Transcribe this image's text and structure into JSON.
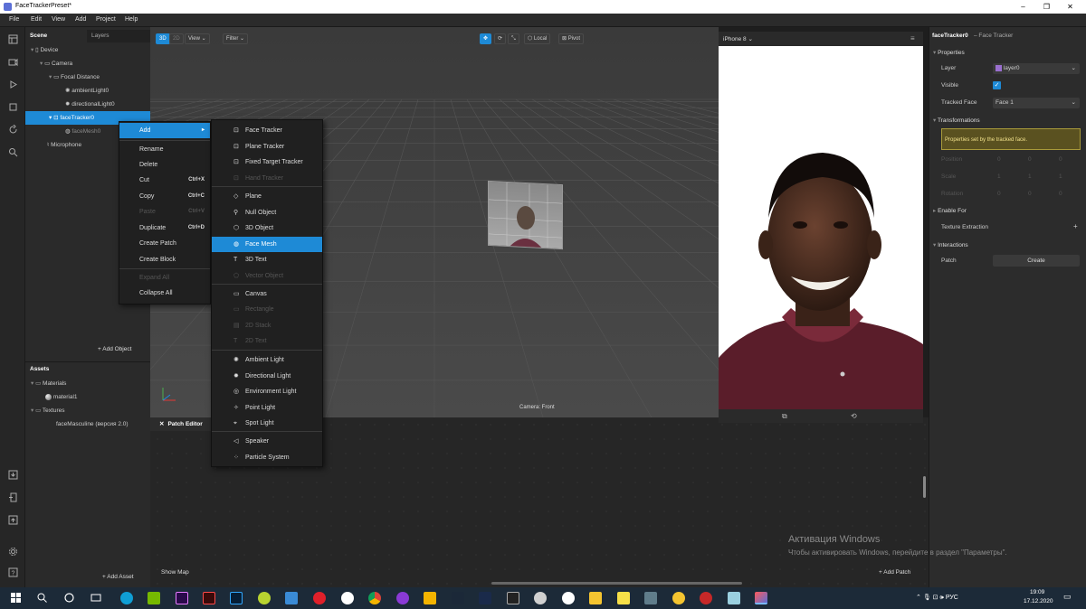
{
  "window": {
    "title": "FaceTrackerPreset*"
  },
  "menu": [
    "File",
    "Edit",
    "View",
    "Add",
    "Project",
    "Help"
  ],
  "scene_panel": {
    "tabs": [
      "Scene",
      "Layers"
    ],
    "tree": [
      {
        "label": "Device",
        "indent": 0
      },
      {
        "label": "Camera",
        "indent": 1
      },
      {
        "label": "Focal Distance",
        "indent": 2
      },
      {
        "label": "ambientLight0",
        "indent": 3
      },
      {
        "label": "directionalLight0",
        "indent": 3
      },
      {
        "label": "faceTracker0",
        "indent": 2,
        "selected": true
      },
      {
        "label": "faceMesh0",
        "indent": 3
      },
      {
        "label": "Microphone",
        "indent": 1
      }
    ],
    "add_object": "Add Object"
  },
  "assets_panel": {
    "title": "Assets",
    "items": [
      "Materials",
      "material1",
      "Textures",
      "faceMasculine (версия 2.0)"
    ],
    "add_asset": "Add Asset"
  },
  "viewport": {
    "toolbar": {
      "mode_3d": "3D",
      "mode_2d": "2D",
      "view": "View",
      "filter": "Filter",
      "local": "Local",
      "pivot": "Pivot"
    },
    "camera_label": "Camera: Front"
  },
  "context_menu": {
    "items": [
      {
        "label": "Add",
        "highlight": true
      },
      {
        "label": "Rename"
      },
      {
        "label": "Delete"
      },
      {
        "label": "Cut",
        "shortcut": "Ctrl+X"
      },
      {
        "label": "Copy",
        "shortcut": "Ctrl+C"
      },
      {
        "label": "Paste",
        "shortcut": "Ctrl+V",
        "disabled": true
      },
      {
        "label": "Duplicate",
        "shortcut": "Ctrl+D"
      },
      {
        "label": "Create Patch"
      },
      {
        "label": "Create Block"
      },
      {
        "label": "Expand All",
        "disabled": true
      },
      {
        "label": "Collapse All"
      }
    ]
  },
  "submenu": {
    "items": [
      {
        "label": "Face Tracker",
        "icon": "face-tracker-icon"
      },
      {
        "label": "Plane Tracker",
        "icon": "plane-tracker-icon"
      },
      {
        "label": "Fixed Target Tracker",
        "icon": "target-tracker-icon"
      },
      {
        "label": "Hand Tracker",
        "icon": "hand-tracker-icon",
        "disabled": true
      },
      {
        "label": "Plane",
        "icon": "plane-icon"
      },
      {
        "label": "Null Object",
        "icon": "null-object-icon"
      },
      {
        "label": "3D Object",
        "icon": "cube-icon"
      },
      {
        "label": "Face Mesh",
        "icon": "face-mesh-icon",
        "highlight": true
      },
      {
        "label": "3D Text",
        "icon": "text-icon"
      },
      {
        "label": "Vector Object",
        "icon": "vector-icon",
        "disabled": true
      },
      {
        "label": "Canvas",
        "icon": "canvas-icon"
      },
      {
        "label": "Rectangle",
        "icon": "rectangle-icon",
        "disabled": true
      },
      {
        "label": "2D Stack",
        "icon": "stack-icon",
        "disabled": true
      },
      {
        "label": "2D Text",
        "icon": "text-icon",
        "disabled": true
      },
      {
        "label": "Ambient Light",
        "icon": "ambient-light-icon"
      },
      {
        "label": "Directional Light",
        "icon": "directional-light-icon"
      },
      {
        "label": "Environment Light",
        "icon": "environment-light-icon"
      },
      {
        "label": "Point Light",
        "icon": "point-light-icon"
      },
      {
        "label": "Spot Light",
        "icon": "spot-light-icon"
      },
      {
        "label": "Speaker",
        "icon": "speaker-icon"
      },
      {
        "label": "Particle System",
        "icon": "particle-icon"
      }
    ]
  },
  "preview": {
    "device": "iPhone 8"
  },
  "patch_editor": {
    "title": "Patch Editor",
    "show_map": "Show Map",
    "add_patch": "Add Patch"
  },
  "inspector": {
    "object_name": "faceTracker0",
    "object_type": "– Face Tracker",
    "sections": {
      "properties": "Properties",
      "transformations": "Transformations",
      "enable_for": "Enable For",
      "texture_extraction": "Texture Extraction",
      "interactions": "Interactions"
    },
    "layer_label": "Layer",
    "layer_value": "layer0",
    "visible_label": "Visible",
    "tracked_face_label": "Tracked Face",
    "tracked_face_value": "Face 1",
    "note": "Properties set by the tracked face.",
    "position_label": "Position",
    "scale_label": "Scale",
    "rotation_label": "Rotation",
    "position_values": [
      "0",
      "0",
      "0"
    ],
    "scale_values": [
      "1",
      "1",
      "1"
    ],
    "rotation_values": [
      "0",
      "0",
      "0"
    ],
    "patch_label": "Patch",
    "create_button": "Create"
  },
  "watermark": {
    "title": "Активация Windows",
    "subtitle": "Чтобы активировать Windows, перейдите в раздел \"Параметры\"."
  },
  "taskbar": {
    "lang": "РУС",
    "time": "19:09",
    "date": "17.12.2020"
  },
  "colors": {
    "accent": "#1e8ad6",
    "note_bg": "#5a5120"
  }
}
